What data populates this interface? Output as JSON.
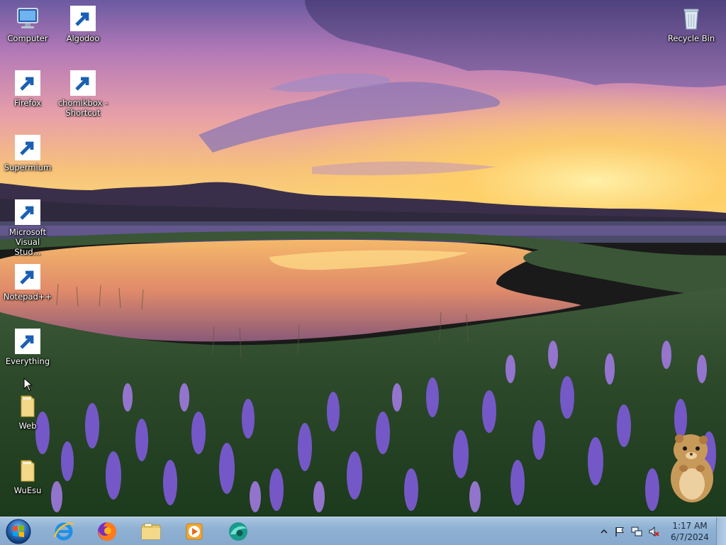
{
  "desktop_icons": [
    {
      "name": "Computer",
      "icon": "computer-icon",
      "shortcut": false
    },
    {
      "name": "Algodoo",
      "icon": "algodoo-icon",
      "shortcut": true
    },
    {
      "name": "Firefox",
      "icon": "firefox-icon",
      "shortcut": true
    },
    {
      "name": "chomikbox - Shortcut",
      "icon": "chomikbox-icon",
      "shortcut": true
    },
    {
      "name": "Supermium",
      "icon": "supermium-icon",
      "shortcut": true
    },
    {
      "name": "Microsoft Visual Stud...",
      "icon": "visual-studio-icon",
      "shortcut": true
    },
    {
      "name": "Notepad++",
      "icon": "notepadpp-icon",
      "shortcut": true
    },
    {
      "name": "Everything",
      "icon": "everything-icon",
      "shortcut": true
    },
    {
      "name": "Web",
      "icon": "folder-icon",
      "shortcut": false
    },
    {
      "name": "WuEsu",
      "icon": "folder-icon",
      "shortcut": false
    },
    {
      "name": "Recycle Bin",
      "icon": "recycle-bin-icon",
      "shortcut": false
    }
  ],
  "taskbar": {
    "start_icon": "windows-start-orb",
    "pinned": [
      {
        "icon": "internet-explorer-icon"
      },
      {
        "icon": "firefox-icon"
      },
      {
        "icon": "file-explorer-icon"
      },
      {
        "icon": "media-player-icon"
      },
      {
        "icon": "supermium-icon"
      }
    ],
    "tray": {
      "icons": [
        "show-hidden-icons-chevron",
        "action-center-flag-icon",
        "network-icon",
        "volume-muted-icon"
      ],
      "time": "1:17 AM",
      "date": "6/7/2024"
    }
  },
  "colors": {
    "taskbar": "#8fb1d3",
    "label_text": "#ffffff"
  }
}
